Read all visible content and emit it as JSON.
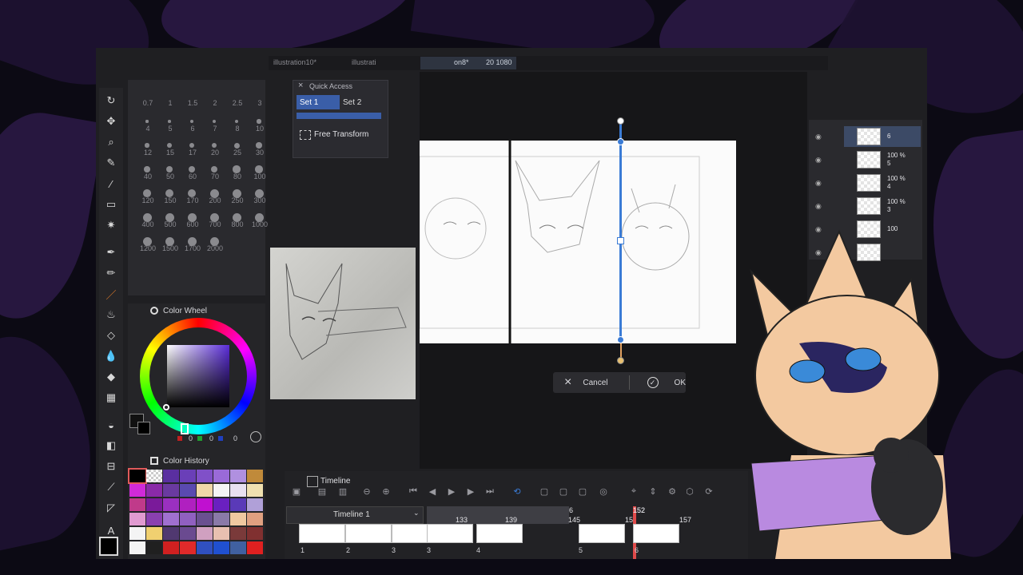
{
  "quick_access": {
    "title": "Quick Access",
    "set1": "Set 1",
    "set2": "Set 2",
    "item": "Free Transform"
  },
  "brush_sizes": [
    "0.7",
    "1",
    "1.5",
    "2",
    "2.5",
    "3",
    "4",
    "5",
    "6",
    "7",
    "8",
    "10",
    "12",
    "15",
    "17",
    "20",
    "25",
    "30",
    "40",
    "50",
    "60",
    "70",
    "80",
    "100",
    "120",
    "150",
    "170",
    "200",
    "250",
    "300",
    "400",
    "500",
    "600",
    "700",
    "800",
    "1000",
    "1200",
    "1500",
    "1700",
    "2000"
  ],
  "color_wheel": {
    "title": "Color Wheel",
    "r": "0",
    "g": "0",
    "b": "0"
  },
  "color_history": {
    "title": "Color History",
    "swatches": [
      "#000000",
      "checker",
      "#5a2fa0",
      "#6a3fb8",
      "#8050c8",
      "#9a6ad8",
      "#b090e0",
      "#c08a3a",
      "#d02ad8",
      "#8a2aa8",
      "#6a3aa0",
      "#5a4ab0",
      "#f0d8a8",
      "#f4f4f4",
      "#e8e0f0",
      "#f0e0b0",
      "#c03a8a",
      "#7a1a9a",
      "#9a30c0",
      "#b020c0",
      "#c010d0",
      "#6a20c0",
      "#5a3ab8",
      "#b0a0d8",
      "#e09ad0",
      "#8a40b0",
      "#a070d0",
      "#9060c0",
      "#6a5090",
      "#8a7aa8",
      "#f0c8a0",
      "#e0a080",
      "#f4f4f4",
      "#f0d070",
      "#503870",
      "#6a4a90",
      "#d0a0c0",
      "#e8c0b0",
      "#7a3a3a",
      "#803030",
      "#f4f4f4",
      "#202020",
      "#d02020",
      "#e02a2a",
      "#3050c0",
      "#2050d0",
      "#4060a0",
      "#e02020"
    ]
  },
  "dialog": {
    "cancel": "Cancel",
    "ok": "OK"
  },
  "timeline": {
    "title": "Timeline",
    "name": "Timeline 1",
    "ruler": [
      "133",
      "139",
      "145",
      "15",
      "152",
      "157",
      "6",
      "152"
    ],
    "frames": [
      "1",
      "2",
      "3",
      "3",
      "4",
      "5",
      "6"
    ]
  },
  "layers": [
    {
      "pct": "",
      "num": "6"
    },
    {
      "pct": "100 %",
      "num": "5"
    },
    {
      "pct": "100 %",
      "num": "4"
    },
    {
      "pct": "100 %",
      "num": "3"
    },
    {
      "pct": "100",
      "num": ""
    },
    {
      "pct": "",
      "num": ""
    }
  ],
  "tabs": [
    "illustration10*",
    "illustrati",
    "on8*",
    "20 1080"
  ],
  "accent": "#3a7bd5",
  "playhead_color": "#e04a4a"
}
